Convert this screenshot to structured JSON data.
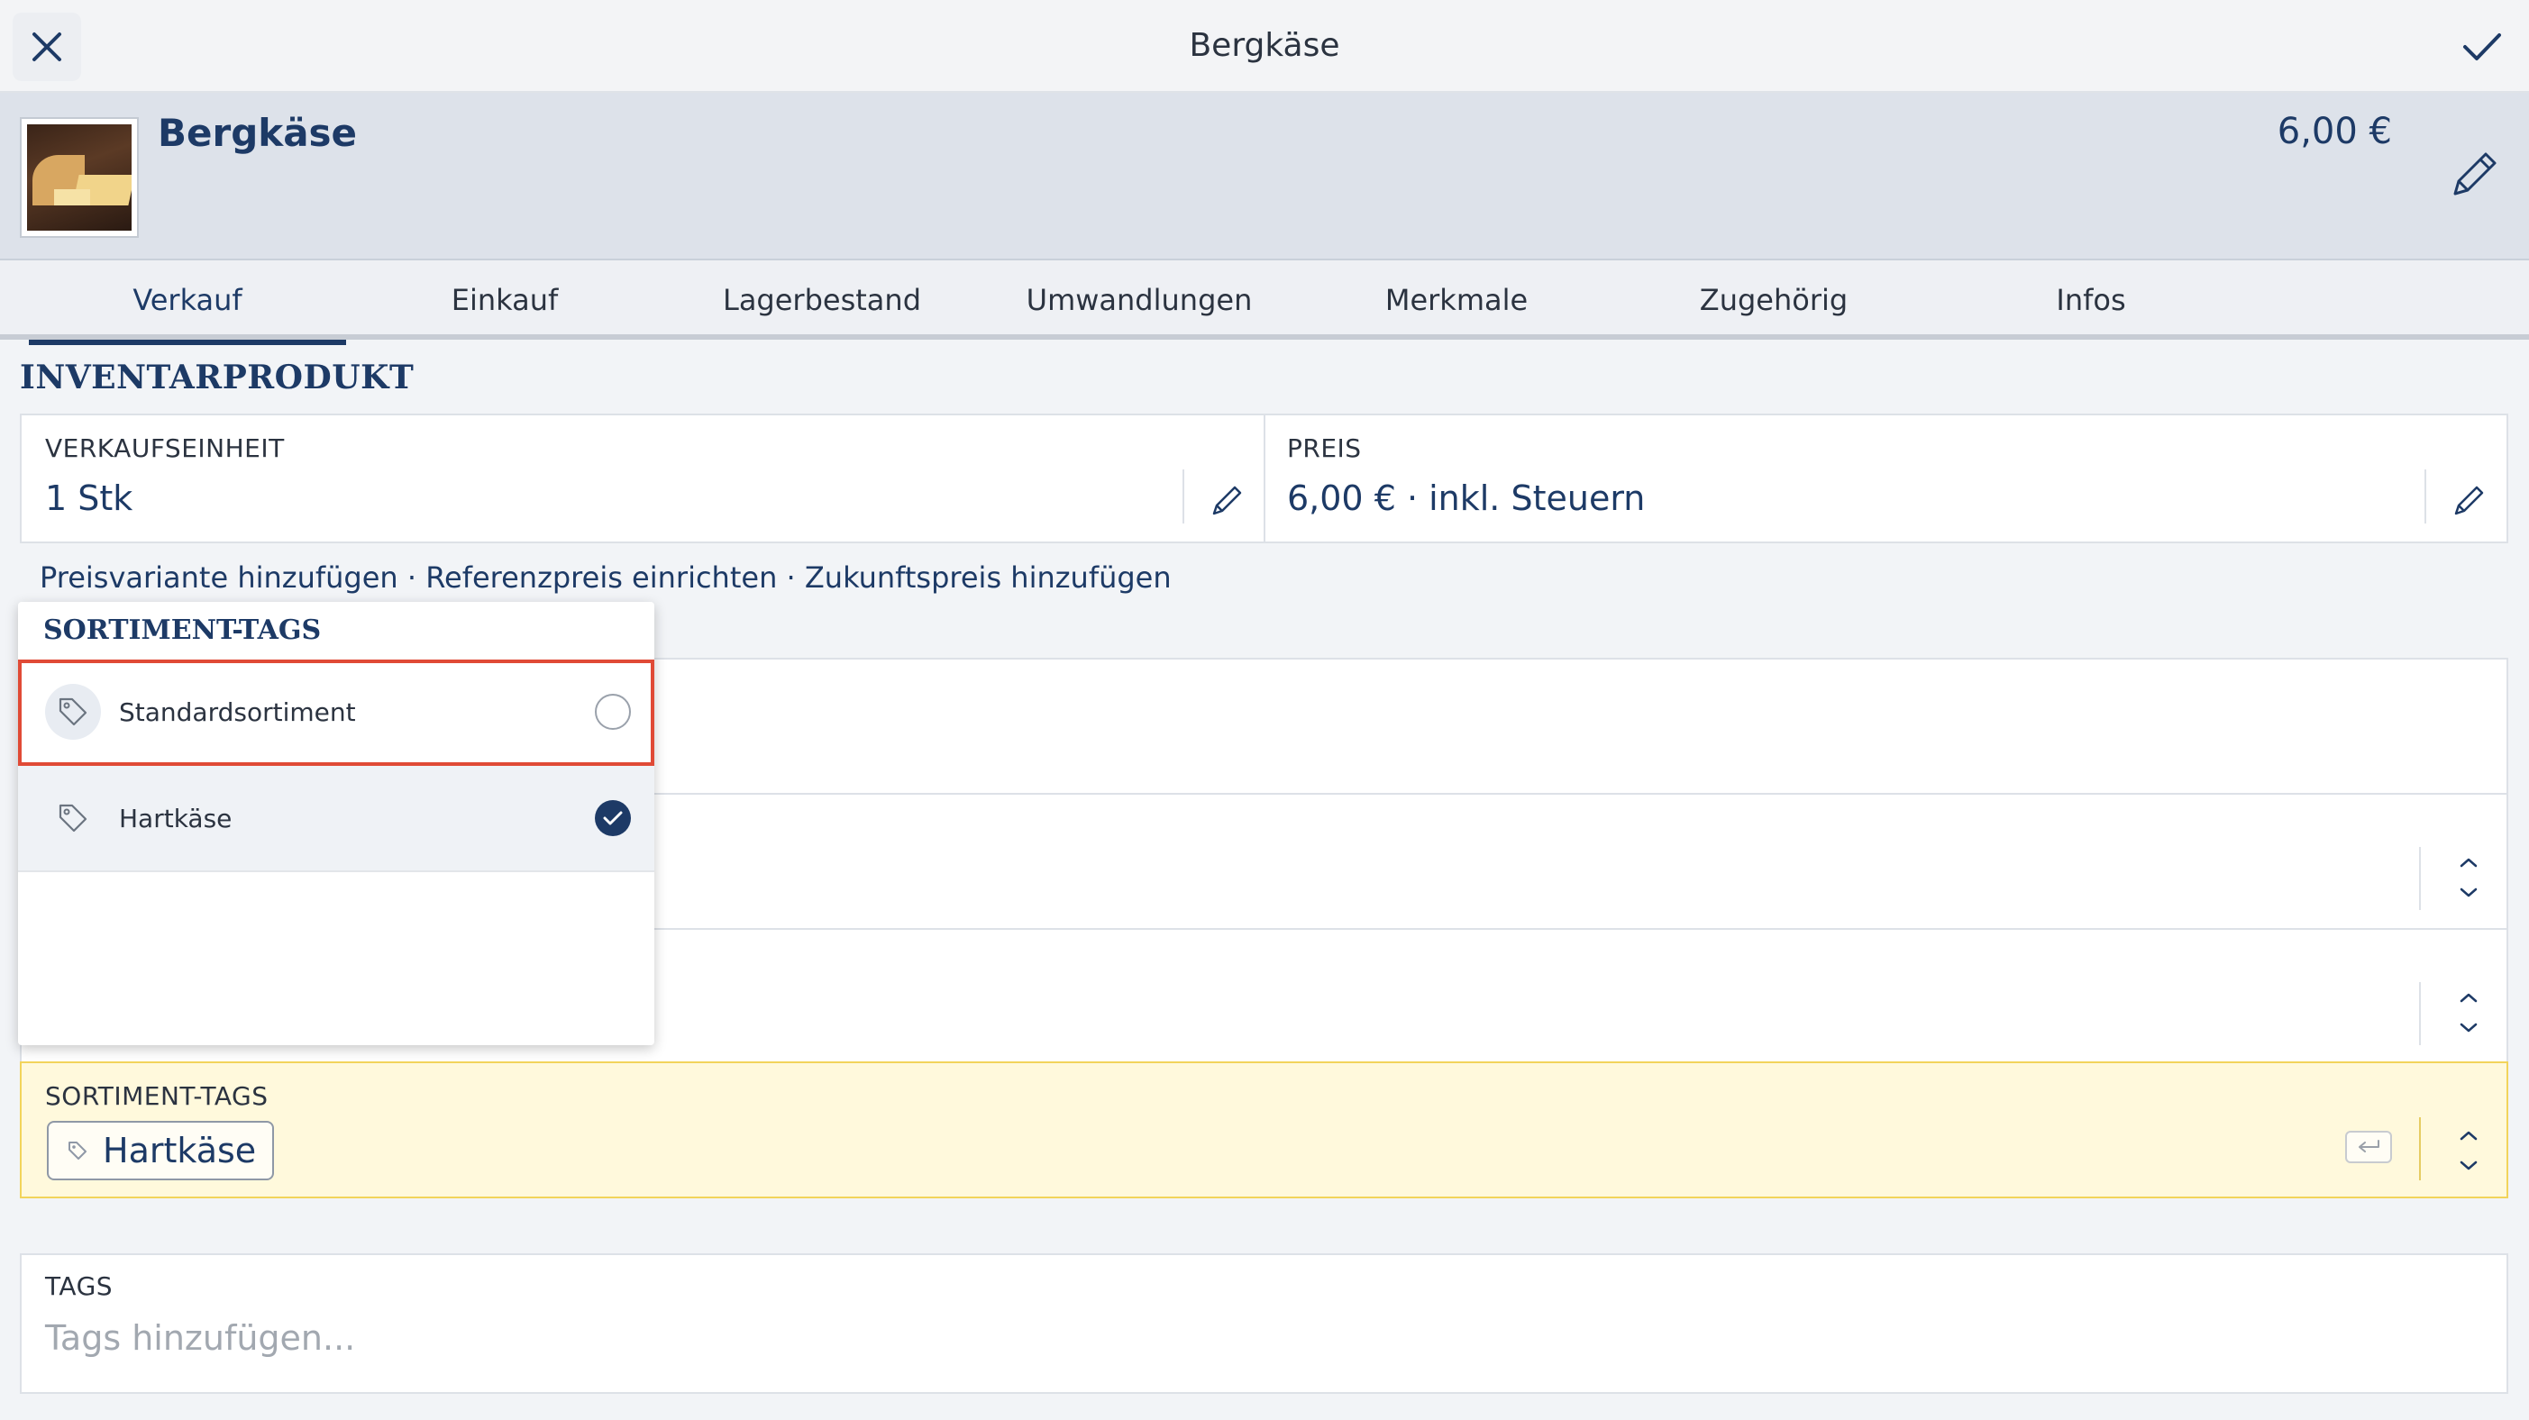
{
  "topbar": {
    "title": "Bergkäse"
  },
  "product": {
    "name": "Bergkäse",
    "price": "6,00 €"
  },
  "tabs": [
    {
      "label": "Verkauf",
      "active": true
    },
    {
      "label": "Einkauf"
    },
    {
      "label": "Lagerbestand"
    },
    {
      "label": "Umwandlungen"
    },
    {
      "label": "Merkmale"
    },
    {
      "label": "Zugehörig"
    },
    {
      "label": "Infos"
    }
  ],
  "section": {
    "title": "INVENTARPRODUKT"
  },
  "sales_unit": {
    "label": "VERKAUFSEINHEIT",
    "value": "1 Stk"
  },
  "price_field": {
    "label": "PREIS",
    "value": "6,00 € · inkl. Steuern"
  },
  "links": {
    "price_variant": "Preisvariante hinzufügen",
    "reference_price": "Referenzpreis einrichten",
    "future_price": "Zukunftspreis hinzufügen",
    "separator": " · "
  },
  "dropdown": {
    "title": "SORTIMENT-TAGS",
    "items": [
      {
        "label": "Standardsortiment",
        "checked": false,
        "highlighted": true
      },
      {
        "label": "Hartkäse",
        "checked": true
      }
    ]
  },
  "assortment_tags": {
    "label": "SORTIMENT-TAGS",
    "chip": "Hartkäse"
  },
  "tags": {
    "label": "TAGS",
    "placeholder": "Tags hinzufügen..."
  },
  "colors": {
    "accent": "#1d3a66",
    "highlight_border": "#e04a36",
    "warning_bg": "#fff9dc",
    "warning_border": "#f2d45b"
  },
  "icons": [
    "close-icon",
    "check-icon",
    "pencil-icon",
    "tag-icon",
    "chevron-up-down-icon",
    "undo-icon"
  ]
}
